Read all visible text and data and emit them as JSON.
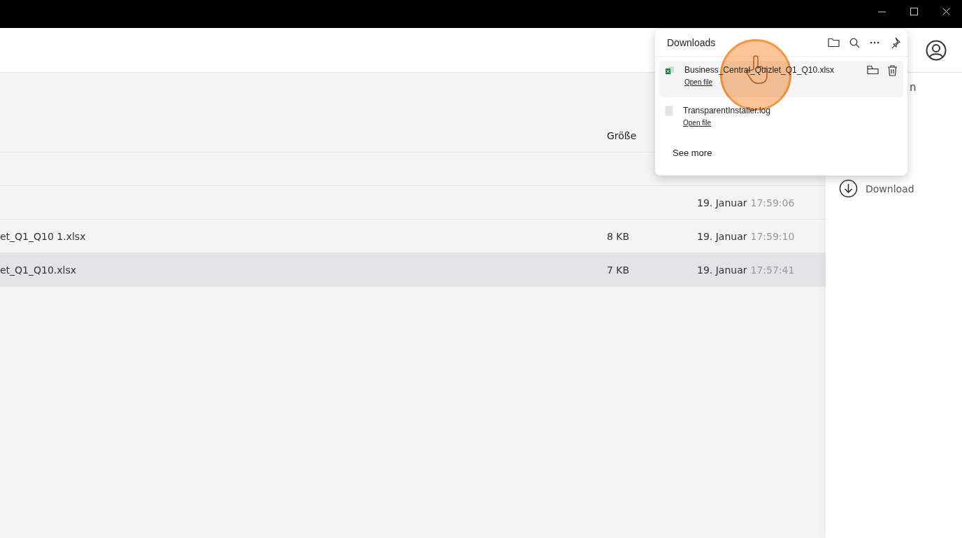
{
  "table": {
    "columns": [
      {
        "label": "Größe"
      }
    ],
    "rows": [
      {
        "selected": false
      },
      {
        "date": "19. Januar",
        "time": "17:59:06",
        "selected": false
      },
      {
        "name": "et_Q1_Q10 1.xlsx",
        "size": "8 KB",
        "date": "19. Januar",
        "time": "17:59:10",
        "selected": false
      },
      {
        "name": "et_Q1_Q10.xlsx",
        "size": "7 KB",
        "date": "19. Januar",
        "time": "17:57:41",
        "selected": true
      }
    ]
  },
  "side_panel": {
    "partial_text": "n",
    "actions": [
      {
        "label": "Download"
      }
    ]
  },
  "downloads": {
    "title": "Downloads",
    "items": [
      {
        "name": "Business_Central_Quizlet_Q1_Q10.xlsx",
        "kind": "excel",
        "link": "Open file",
        "highlighted": true
      },
      {
        "name": "TransparentInstaller.log",
        "kind": "text",
        "link": "Open file",
        "highlighted": false
      }
    ],
    "see_more": "See more"
  }
}
